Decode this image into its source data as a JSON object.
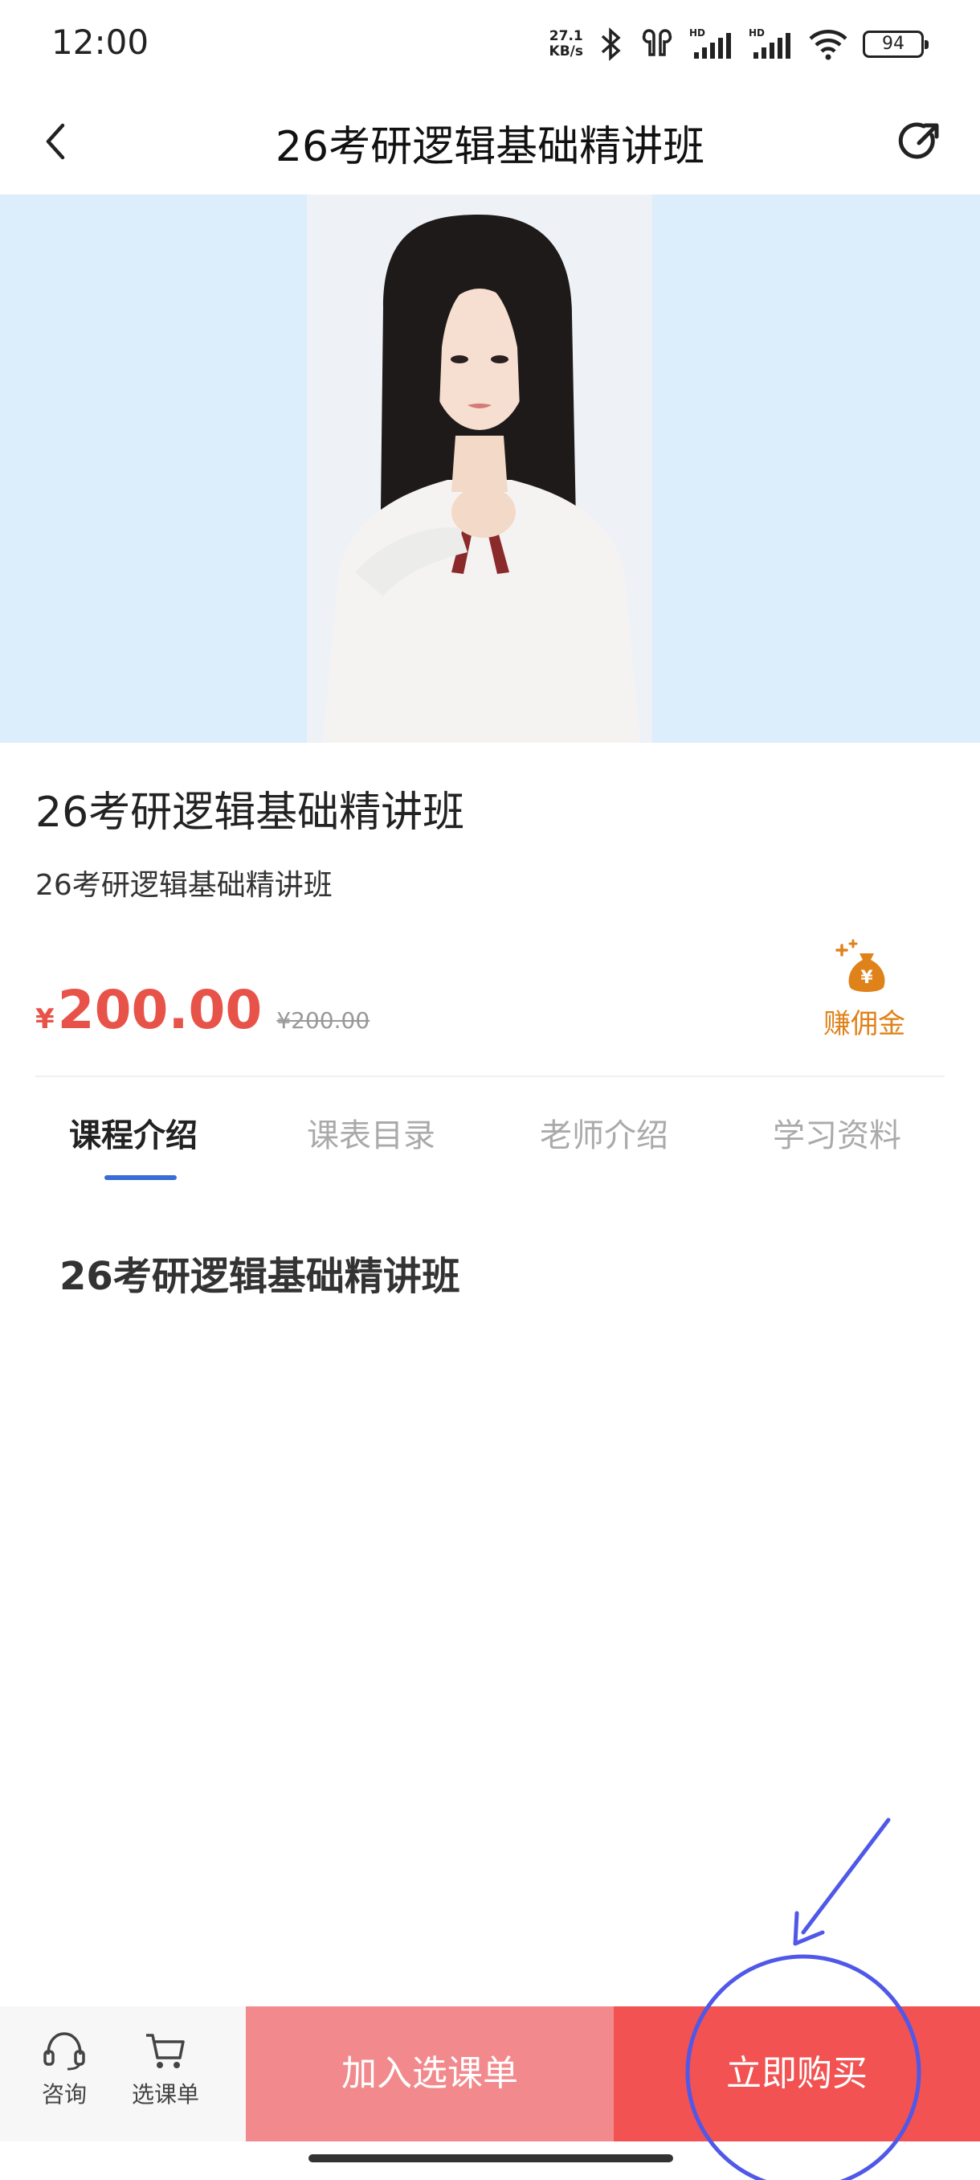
{
  "status_bar": {
    "time": "12:00",
    "net_speed_value": "27.1",
    "net_speed_unit": "KB/s",
    "battery": "94"
  },
  "nav": {
    "title": "26考研逻辑基础精讲班"
  },
  "course": {
    "title": "26考研逻辑基础精讲班",
    "subtitle": "26考研逻辑基础精讲班",
    "currency": "¥",
    "price": "200.00",
    "original_price": "¥200.00",
    "commission_label": "赚佣金"
  },
  "tabs": [
    {
      "label": "课程介绍",
      "active": true
    },
    {
      "label": "课表目录",
      "active": false
    },
    {
      "label": "老师介绍",
      "active": false
    },
    {
      "label": "学习资料",
      "active": false
    }
  ],
  "content": {
    "heading": "26考研逻辑基础精讲班"
  },
  "bottom_bar": {
    "consult_label": "咨询",
    "cart_label": "选课单",
    "add_to_cart_label": "加入选课单",
    "buy_now_label": "立即购买"
  },
  "colors": {
    "price_red": "#e85349",
    "tab_indicator": "#3a6cd6",
    "add_button": "#f28a8d",
    "buy_button": "#f25252",
    "hero_background": "#dcedfb",
    "annotation": "#4f58e8"
  }
}
